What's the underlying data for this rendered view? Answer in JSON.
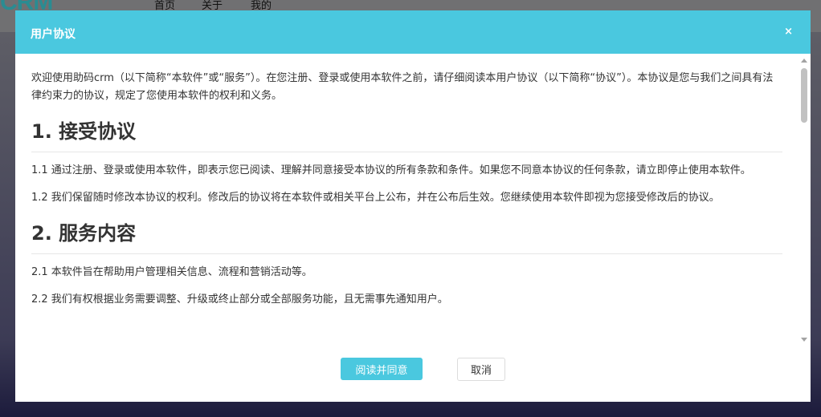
{
  "background": {
    "logo_text": "CRM",
    "nav": [
      "首页",
      "关于",
      "我的"
    ]
  },
  "modal": {
    "title": "用户协议",
    "close_symbol": "×",
    "intro": "欢迎使用助码crm（以下简称“本软件”或“服务”）。在您注册、登录或使用本软件之前，请仔细阅读本用户协议（以下简称“协议”）。本协议是您与我们之间具有法律约束力的协议，规定了您使用本软件的权利和义务。",
    "sections": [
      {
        "heading": "1. 接受协议",
        "items": [
          "1.1 通过注册、登录或使用本软件，即表示您已阅读、理解并同意接受本协议的所有条款和条件。如果您不同意本协议的任何条款，请立即停止使用本软件。",
          "1.2 我们保留随时修改本协议的权利。修改后的协议将在本软件或相关平台上公布，并在公布后生效。您继续使用本软件即视为您接受修改后的协议。"
        ]
      },
      {
        "heading": "2. 服务内容",
        "items": [
          "2.1 本软件旨在帮助用户管理相关信息、流程和营销活动等。",
          "2.2 我们有权根据业务需要调整、升级或终止部分或全部服务功能，且无需事先通知用户。"
        ]
      }
    ],
    "agree_label": "阅读并同意",
    "cancel_label": "取消"
  },
  "colors": {
    "accent": "#4ac8df",
    "overlay": "#3c3b55"
  }
}
